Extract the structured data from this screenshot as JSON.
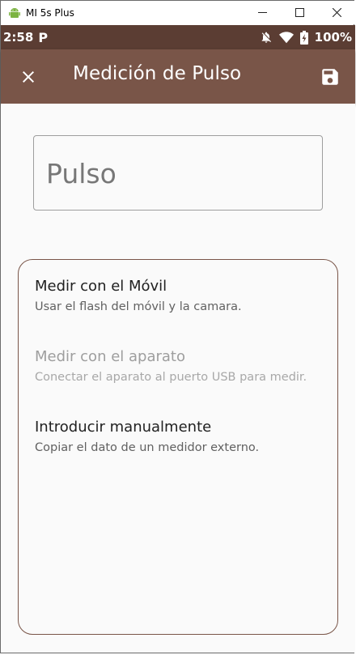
{
  "window": {
    "title": "MI 5s Plus",
    "minimize_label": "—",
    "maximize_label": "☐",
    "close_label": "✕"
  },
  "status_bar": {
    "time": "2:58",
    "app_indicator": "P",
    "battery_percent": "100%"
  },
  "app_bar": {
    "title": "Medición de Pulso",
    "background": "#795548"
  },
  "pulse_input": {
    "placeholder": "Pulso",
    "value": ""
  },
  "options": [
    {
      "title": "Medir con el Móvil",
      "subtitle": "Usar el flash del móvil y la camara.",
      "enabled": true
    },
    {
      "title": "Medir con el aparato",
      "subtitle": "Conectar el aparato al puerto USB para medir.",
      "enabled": false
    },
    {
      "title": "Introducir manualmente",
      "subtitle": "Copiar el dato de un medidor externo.",
      "enabled": true
    }
  ],
  "colors": {
    "status_bar": "#5b3d33",
    "app_bar": "#795548",
    "card_border": "#795548",
    "background": "#fafafa"
  }
}
